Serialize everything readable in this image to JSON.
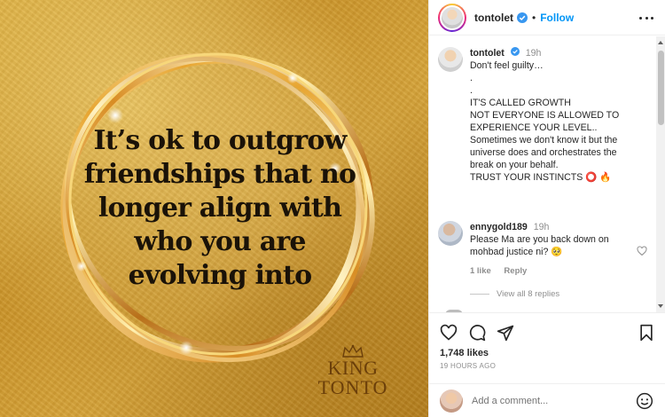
{
  "post": {
    "quote": "It’s ok to outgrow friendships that no longer align with who you are evolving into",
    "brand_top": "KING",
    "brand_bottom": "TONTO"
  },
  "header": {
    "username": "tontolet",
    "separator": "•",
    "follow_label": "Follow"
  },
  "caption": {
    "username": "tontolet",
    "time": "19h",
    "lines": [
      "Don't feel guilty…",
      ".",
      ".",
      "IT'S CALLED GROWTH",
      "NOT EVERYONE IS ALLOWED TO",
      "EXPERIENCE YOUR LEVEL..",
      "Sometimes we don't know it but the",
      "universe does and orchestrates the",
      "break on your behalf.",
      "TRUST YOUR INSTINCTS ⭕ 🔥"
    ]
  },
  "comment": {
    "username": "ennygold189",
    "time": "19h",
    "text": "Please Ma are you back down on mohbad justice ni? 🥺",
    "likes_label": "1 like",
    "reply_label": "Reply",
    "view_replies": "View all 8 replies"
  },
  "stats": {
    "likes": "1,748 likes",
    "ago": "19 HOURS AGO"
  },
  "add_comment": {
    "placeholder": "Add a comment..."
  },
  "colors": {
    "link_blue": "#0095f6",
    "verified_blue": "#3897f0",
    "muted": "#8e8e8e",
    "gold": "#d9a93a"
  },
  "icons": [
    "verified-badge-icon",
    "more-options-icon",
    "heart-icon",
    "comment-icon",
    "share-icon",
    "bookmark-icon",
    "emoji-icon",
    "crown-icon"
  ]
}
